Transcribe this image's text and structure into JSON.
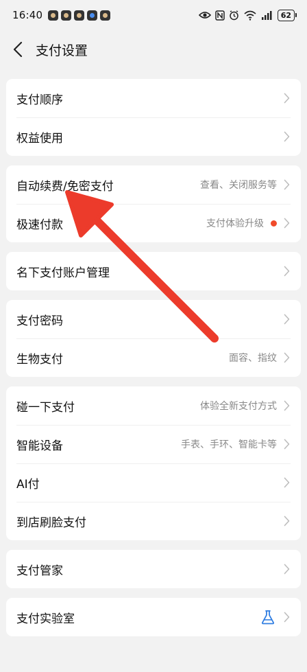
{
  "status_bar": {
    "time": "16:40",
    "battery": "62"
  },
  "nav": {
    "title": "支付设置"
  },
  "groups": [
    {
      "items": [
        {
          "label": "支付顺序"
        },
        {
          "label": "权益使用"
        }
      ]
    },
    {
      "items": [
        {
          "label": "自动续费/免密支付",
          "sub": "查看、关闭服务等"
        },
        {
          "label": "极速付款",
          "sub": "支付体验升级"
        }
      ]
    },
    {
      "items": [
        {
          "label": "名下支付账户管理"
        }
      ]
    },
    {
      "items": [
        {
          "label": "支付密码"
        },
        {
          "label": "生物支付",
          "sub": "面容、指纹"
        }
      ]
    },
    {
      "items": [
        {
          "label": "碰一下支付",
          "sub": "体验全新支付方式"
        },
        {
          "label": "智能设备",
          "sub": "手表、手环、智能卡等"
        },
        {
          "label": "AI付"
        },
        {
          "label": "到店刷脸支付"
        }
      ]
    },
    {
      "items": [
        {
          "label": "支付管家"
        }
      ]
    },
    {
      "items": [
        {
          "label": "支付实验室"
        }
      ]
    }
  ],
  "colors": {
    "annotation_arrow": "#ec3b2b",
    "badge_dot": "#f04a2a",
    "flask_icon": "#2f7de1"
  }
}
